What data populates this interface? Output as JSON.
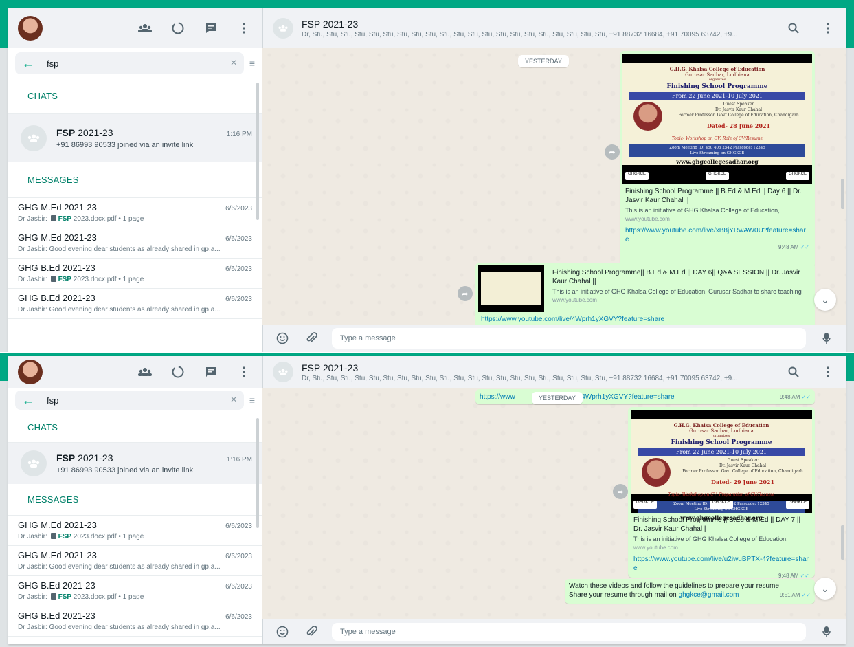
{
  "colors": {
    "accent": "#00a884",
    "bubble_out": "#d9fdd3",
    "link": "#027eb5"
  },
  "shots": [
    {
      "sidebar": {
        "search_query": "fsp",
        "sections": {
          "chats": "CHATS",
          "messages": "MESSAGES"
        },
        "chat_hit": {
          "title_bold": "FSP",
          "title_rest": " 2021-23",
          "time": "1:16 PM",
          "subtitle": "+91 86993 90533 joined via an invite link"
        },
        "messages": [
          {
            "title": "GHG M.Ed 2021-23",
            "date": "6/6/2023",
            "pre": "Dr Jasbir: ",
            "doc": true,
            "bold": "FSP",
            "post": " 2023.docx.pdf • 1 page"
          },
          {
            "title": "GHG M.Ed 2021-23",
            "date": "6/6/2023",
            "pre": "Dr Jasbir: Good evening dear students as already shared in gp.a...",
            "doc": false,
            "bold": "",
            "post": ""
          },
          {
            "title": "GHG B.Ed 2021-23",
            "date": "6/6/2023",
            "pre": "Dr Jasbir: ",
            "doc": true,
            "bold": "FSP",
            "post": " 2023.docx.pdf • 1 page"
          },
          {
            "title": "GHG B.Ed 2021-23",
            "date": "6/6/2023",
            "pre": "Dr Jasbir: Good evening dear students as already shared in gp.a...",
            "doc": false,
            "bold": "",
            "post": ""
          }
        ]
      },
      "header": {
        "title": "FSP 2021-23",
        "members": "Dr, Stu, Stu, Stu, Stu, Stu, Stu, Stu, Stu, Stu, Stu, Stu, Stu, Stu, Stu, Stu, Stu, Stu, Stu, Stu, Stu, Stu, +91 88732 16684, +91 70095 63742, +9..."
      },
      "date_chip": "YESTERDAY",
      "poster": {
        "college": "G.H.G. Khalsa College of Education",
        "place": "Gurusar Sadhar, Ludhiana",
        "organises": "organizes",
        "programme": "Finishing School Programme",
        "span": "From 22 June 2021-10 July 2021",
        "guest": "Guest Speaker",
        "speaker": "Dr. Jasvir Kaur Chahal",
        "speaker_role": "Former Professor, Govt College of Education, Chandigarh",
        "dated": "Dated- 28 June 2021",
        "topic": "Topic- Workshop on CV: Role of CV/Resume",
        "zoom": "Zoom Meeting ID: 450 405 2542   Passcode: 12345",
        "live": "Live Streaming on  GHGKCE",
        "site": "www.ghgcollegesadhar.org",
        "socials": [
          "GHGKCE",
          "GHGKCE",
          "GHGKCE"
        ]
      },
      "main_bubble": {
        "preview_title": "Finishing School Programme || B.Ed & M.Ed || Day 6 || Dr. Jasvir Kaur Chahal ||",
        "preview_desc": "This is an initiative of GHG Khalsa College of Education,",
        "host": "www.youtube.com",
        "url": "https://www.youtube.com/live/xB8jYRwAW0U?feature=share",
        "time": "9:48 AM"
      },
      "lower_bubble": {
        "preview_title": "Finishing School Programme|| B.Ed & M.Ed || DAY 6|| Q&A SESSION || Dr. Jasvir Kaur Chahal ||",
        "preview_desc": "This is an initiative of GHG Khalsa College of Education, Gurusar Sadhar to share teaching",
        "host": "www.youtube.com",
        "url": "https://www.youtube.com/live/4Wprh1yXGVY?feature=share"
      },
      "composer": {
        "placeholder": "Type a message"
      }
    },
    {
      "sidebar": {
        "search_query": "fsp",
        "sections": {
          "chats": "CHATS",
          "messages": "MESSAGES"
        },
        "chat_hit": {
          "title_bold": "FSP",
          "title_rest": " 2021-23",
          "time": "1:16 PM",
          "subtitle": "+91 86993 90533 joined via an invite link"
        },
        "messages": [
          {
            "title": "GHG M.Ed 2021-23",
            "date": "6/6/2023",
            "pre": "Dr Jasbir: ",
            "doc": true,
            "bold": "FSP",
            "post": " 2023.docx.pdf • 1 page"
          },
          {
            "title": "GHG M.Ed 2021-23",
            "date": "6/6/2023",
            "pre": "Dr Jasbir: Good evening dear students as already shared in gp.a...",
            "doc": false,
            "bold": "",
            "post": ""
          },
          {
            "title": "GHG B.Ed 2021-23",
            "date": "6/6/2023",
            "pre": "Dr Jasbir: ",
            "doc": true,
            "bold": "FSP",
            "post": " 2023.docx.pdf • 1 page"
          },
          {
            "title": "GHG B.Ed 2021-23",
            "date": "6/6/2023",
            "pre": "Dr Jasbir: Good evening dear students as already shared in gp.a...",
            "doc": false,
            "bold": "",
            "post": ""
          }
        ]
      },
      "header": {
        "title": "FSP 2021-23",
        "members": "Dr, Stu, Stu, Stu, Stu, Stu, Stu, Stu, Stu, Stu, Stu, Stu, Stu, Stu, Stu, Stu, Stu, Stu, Stu, Stu, Stu, Stu, +91 88732 16684, +91 70095 63742, +9..."
      },
      "date_chip": "YESTERDAY",
      "top_link": {
        "left": "https://www",
        "right": "/live/4Wprh1yXGVY?feature=share",
        "time": "9:48 AM"
      },
      "poster": {
        "college": "G.H.G. Khalsa College of Education",
        "place": "Gurusar Sadhar, Ludhiana",
        "organises": "organizes",
        "programme": "Finishing School Programme",
        "span": "From 22 June 2021-10 July 2021",
        "guest": "Guest Speaker",
        "speaker": "Dr. Jasvir Kaur Chahal",
        "speaker_role": "Former Professor, Govt College of Education, Chandigarh",
        "dated": "Dated- 29 June 2021",
        "topic": "Topic- Workshop on CV: Preparation of CV/Resume",
        "zoom": "Zoom Meeting ID: 450 405 2542   Passcode: 12345",
        "live": "Live Streaming on  GHGKCE",
        "site": "www.ghgcollegesadhar.org",
        "socials": [
          "GHGKCE",
          "GHGKCE",
          "GHGKCE"
        ]
      },
      "main_bubble": {
        "preview_title": "Finishing School Programme || B.Ed & M.Ed || DAY 7 || Dr. Jasvir Kaur Chahal |",
        "preview_desc": "This is an initiative of GHG Khalsa College of Education,",
        "host": "www.youtube.com",
        "url": "https://www.youtube.com/live/u2iwuBPTX-4?feature=share",
        "time": "9:48 AM"
      },
      "text_bubble": {
        "line1": "Watch these videos and follow the guidelines to prepare your resume",
        "line2_pre": "Share your resume through mail on ",
        "email": "ghgkce@gmail.com",
        "time": "9:51 AM"
      },
      "composer": {
        "placeholder": "Type a message"
      }
    }
  ]
}
